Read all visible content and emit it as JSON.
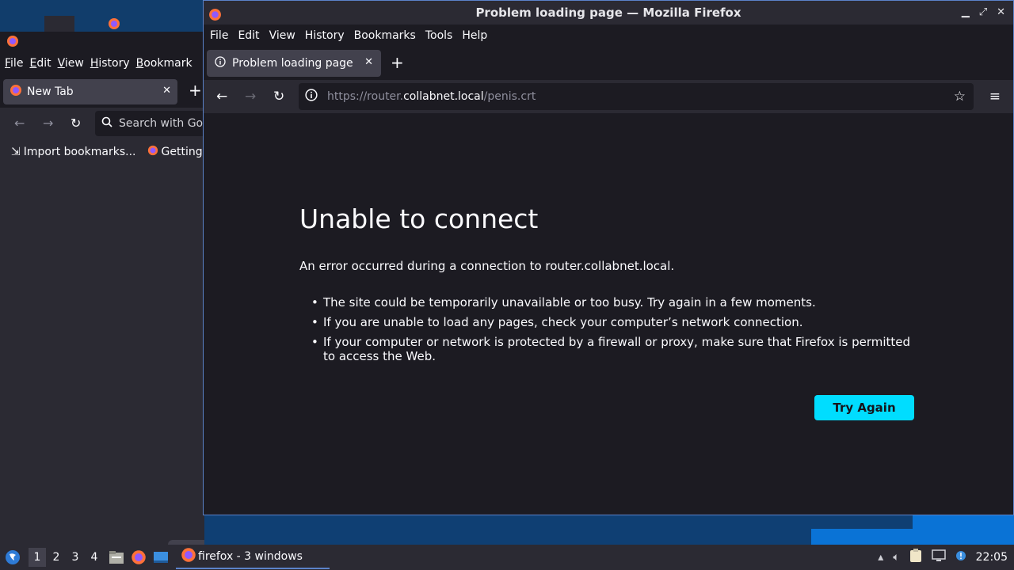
{
  "main_window": {
    "title": "Problem loading page — Mozilla Firefox",
    "menu": [
      "File",
      "Edit",
      "View",
      "History",
      "Bookmarks",
      "Tools",
      "Help"
    ],
    "tab_label": "Problem loading page",
    "url": {
      "prefix": "https://router.",
      "host": "collabnet.local",
      "path": "/penis.crt"
    },
    "error": {
      "title": "Unable to connect",
      "description": "An error occurred during a connection to router.collabnet.local.",
      "bullets": [
        "The site could be temporarily unavailable or too busy. Try again in a few moments.",
        "If you are unable to load any pages, check your computer’s network connection.",
        "If your computer or network is protected by a firewall or proxy, make sure that Firefox is permitted to access the Web."
      ],
      "try_again_label": "Try Again"
    }
  },
  "back_window": {
    "menu": [
      "File",
      "Edit",
      "View",
      "History",
      "Bookmark"
    ],
    "tab_label": "New Tab",
    "search_placeholder": "Search with Go",
    "bookmarks": [
      "Import bookmarks...",
      "Getting"
    ]
  },
  "taskbar": {
    "workspaces": [
      "1",
      "2",
      "3",
      "4"
    ],
    "active_workspace": "1",
    "task_label": "firefox - 3 windows",
    "clock": "22:05"
  },
  "colors": {
    "accent": "#00ddff",
    "window_bg": "#1c1b22",
    "toolbar_bg": "#2b2a33",
    "focus_border": "#5b82c9"
  }
}
